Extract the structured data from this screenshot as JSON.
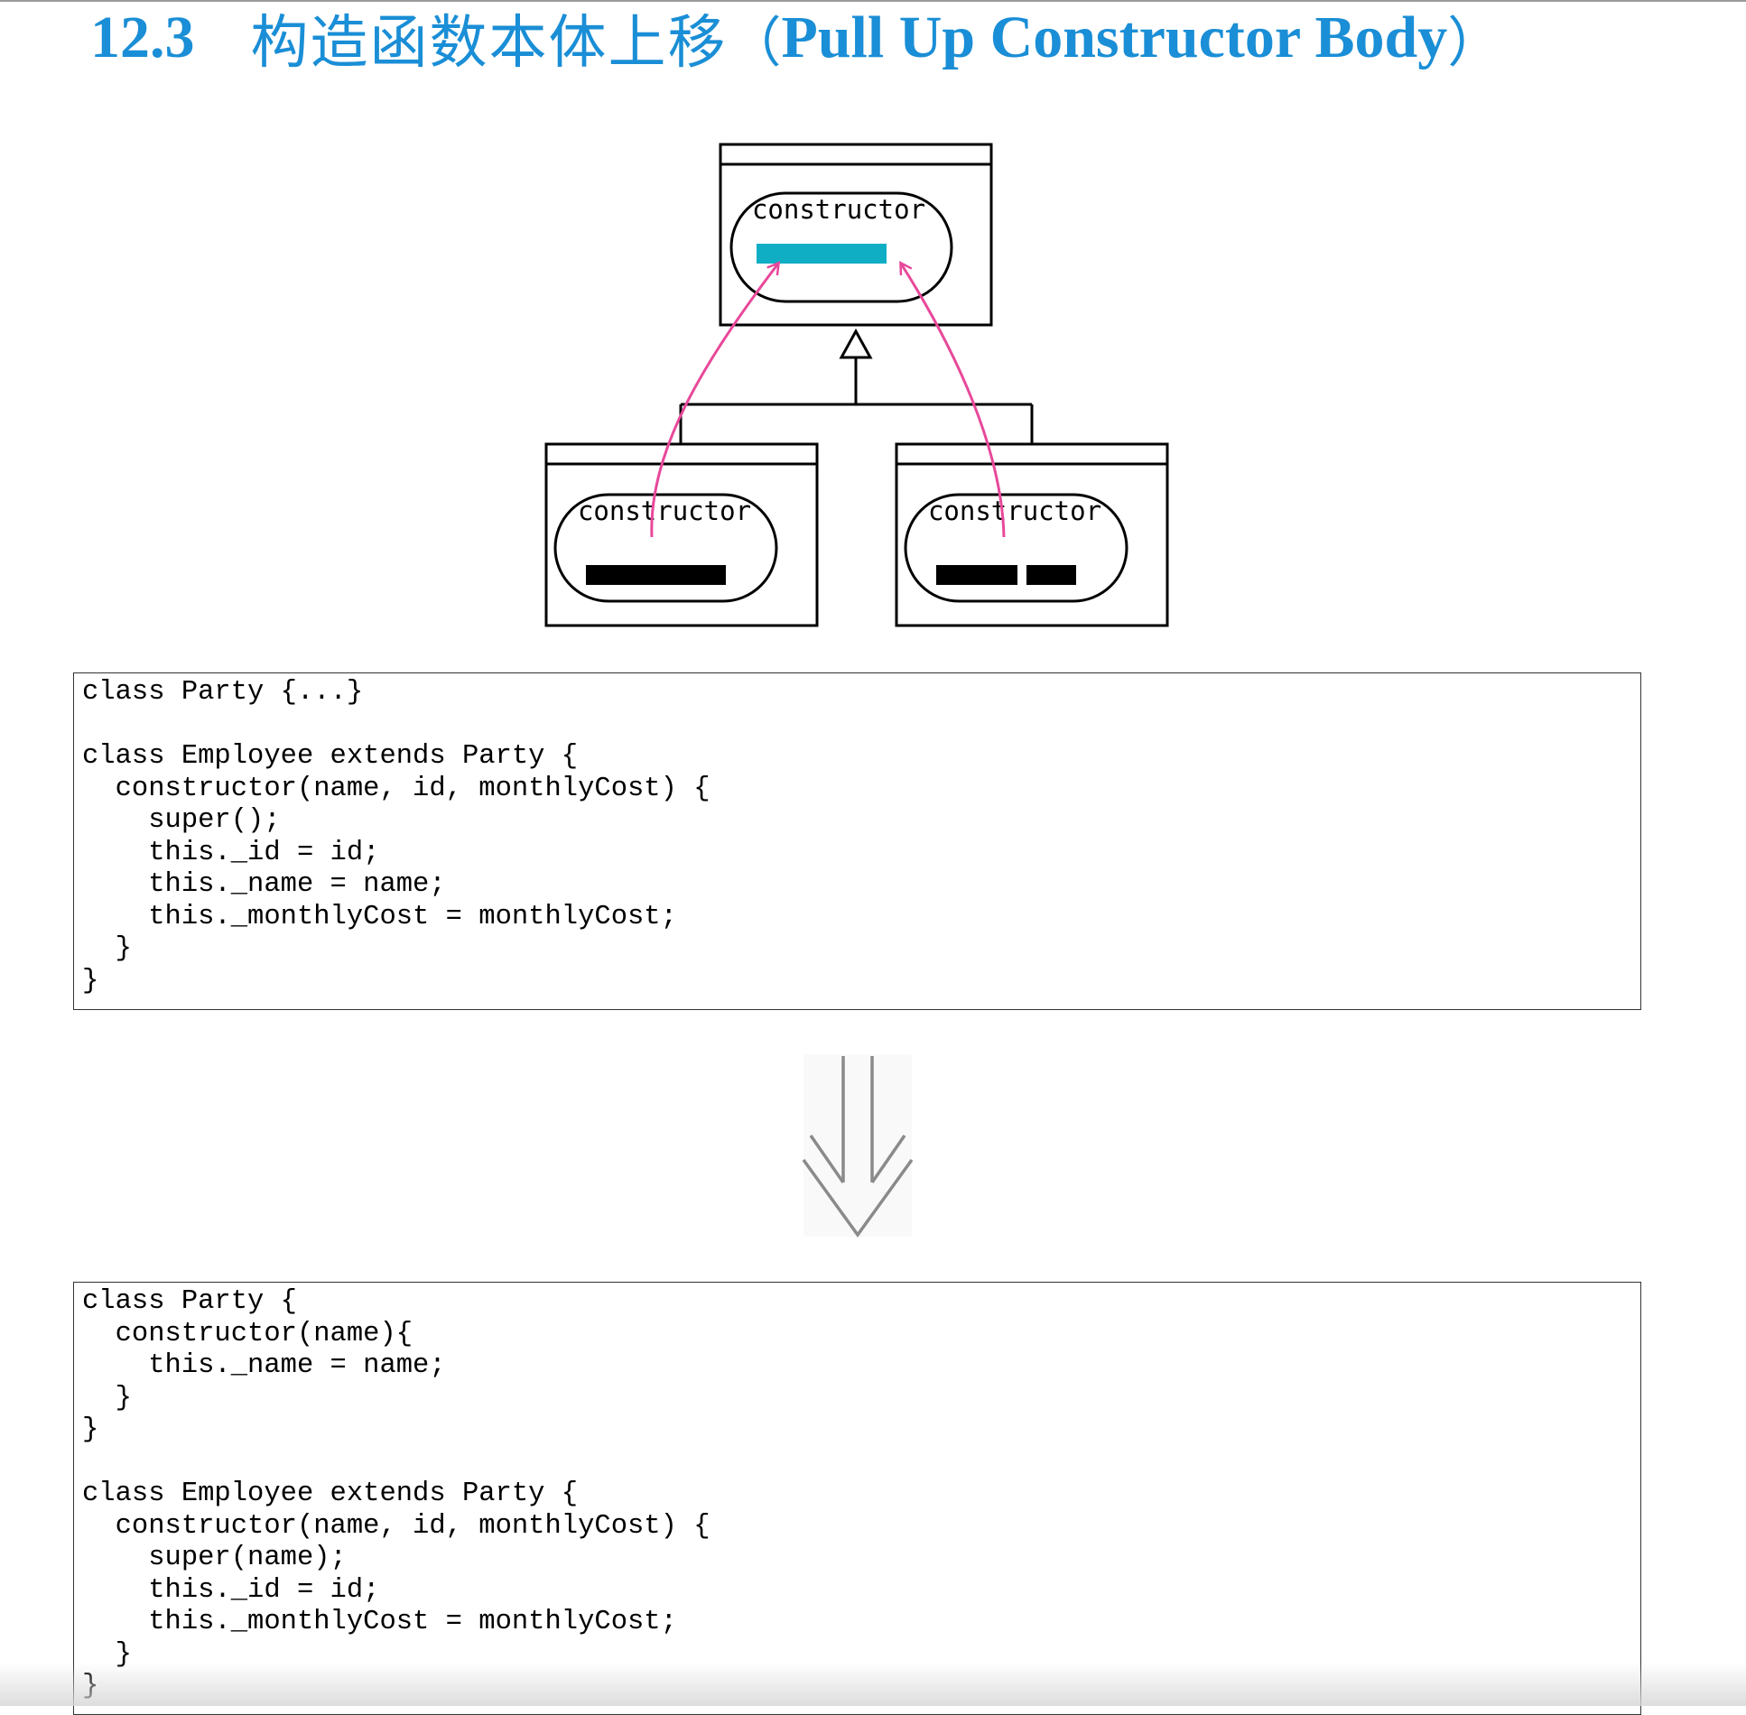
{
  "heading": {
    "number": "12.3",
    "title_zh": "构造函数本体上移",
    "open_paren": "（",
    "title_en": "Pull Up Constructor Body",
    "close_paren": "）"
  },
  "diagram": {
    "superclass_method": "constructor",
    "subclass_left_method": "constructor",
    "subclass_right_method": "constructor",
    "colors": {
      "moved_body": "#10aec5",
      "arrows": "#e8489a",
      "outline": "#000000"
    }
  },
  "code_before": "class Party {...}\n\nclass Employee extends Party {\n  constructor(name, id, monthlyCost) {\n    super();\n    this._id = id;\n    this._name = name;\n    this._monthlyCost = monthlyCost;\n  }\n}",
  "transition_icon": "double-down-arrow-icon",
  "code_after": "class Party {\n  constructor(name){\n    this._name = name;\n  }\n}\n\nclass Employee extends Party {\n  constructor(name, id, monthlyCost) {\n    super(name);\n    this._id = id;\n    this._monthlyCost = monthlyCost;\n  }\n}"
}
